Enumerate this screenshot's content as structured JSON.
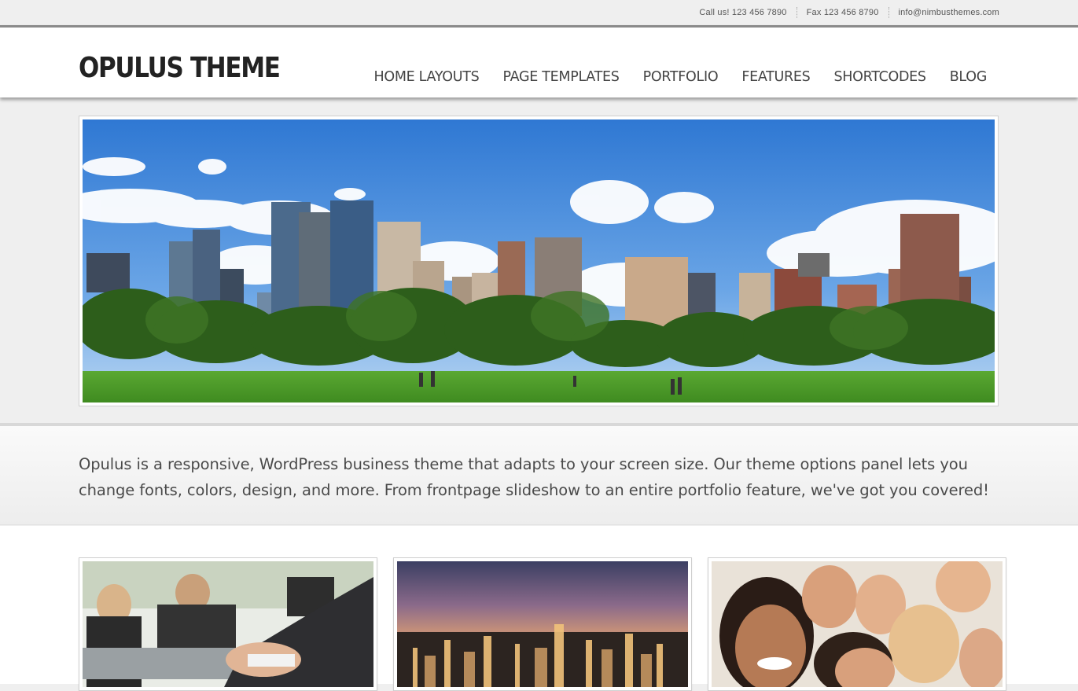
{
  "topbar": {
    "call": "Call us! 123 456 7890",
    "fax": "Fax 123 456 8790",
    "email": "info@nimbusthemes.com"
  },
  "header": {
    "logo": "OPULUS THEME",
    "nav": [
      "HOME LAYOUTS",
      "PAGE TEMPLATES",
      "PORTFOLIO",
      "FEATURES",
      "SHORTCODES",
      "BLOG"
    ]
  },
  "intro": {
    "text": "Opulus is a responsive, WordPress business theme that adapts to your screen size. Our theme options panel lets you change fonts, colors, design, and more. From frontpage slideshow to an entire portfolio feature, we've got you covered!"
  },
  "colors": {
    "page_bg": "#efefef",
    "header_bg": "#ffffff",
    "text": "#4a4a4a",
    "sky": "#3b7fd6",
    "grass": "#4c9a2a"
  },
  "images": {
    "slider": "city-skyline-park-image",
    "thumb1": "business-handshake-image",
    "thumb2": "city-dusk-aerial-image",
    "thumb3": "group-of-smiling-people-image"
  }
}
